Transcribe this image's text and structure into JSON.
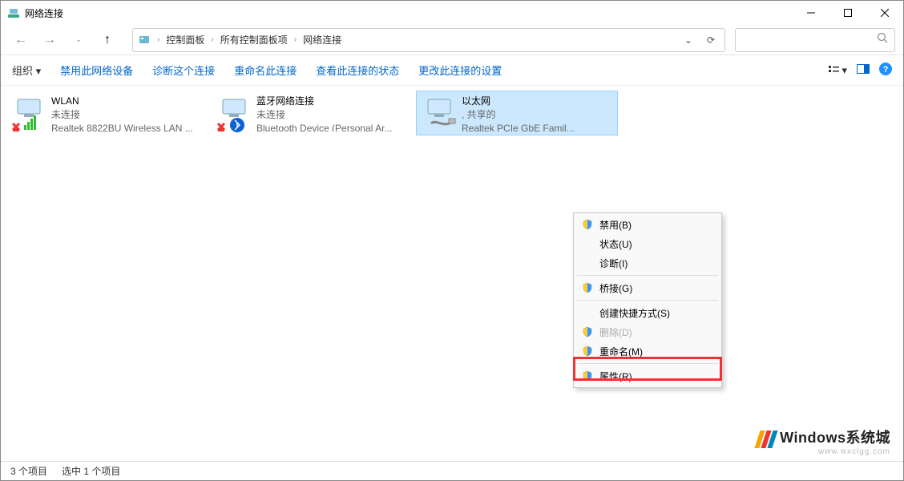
{
  "window": {
    "title": "网络连接"
  },
  "breadcrumbs": [
    "控制面板",
    "所有控制面板项",
    "网络连接"
  ],
  "toolbar": {
    "organize": "组织",
    "actions": [
      "禁用此网络设备",
      "诊断这个连接",
      "重命名此连接",
      "查看此连接的状态",
      "更改此连接的设置"
    ]
  },
  "adapters": [
    {
      "name": "WLAN",
      "status": "未连接",
      "device": "Realtek 8822BU Wireless LAN ..."
    },
    {
      "name": "蓝牙网络连接",
      "status": "未连接",
      "device": "Bluetooth Device (Personal Ar..."
    },
    {
      "name": "以太网",
      "status": ", 共享的",
      "device": "Realtek PCIe GbE Famil..."
    }
  ],
  "context_menu": [
    {
      "label": "禁用(B)",
      "shield": true
    },
    {
      "label": "状态(U)",
      "shield": false
    },
    {
      "label": "诊断(I)",
      "shield": false
    },
    {
      "sep": true
    },
    {
      "label": "桥接(G)",
      "shield": true
    },
    {
      "sep": true
    },
    {
      "label": "创建快捷方式(S)",
      "shield": false
    },
    {
      "label": "删除(D)",
      "shield": true,
      "disabled": true
    },
    {
      "label": "重命名(M)",
      "shield": true
    },
    {
      "sep": true
    },
    {
      "label": "属性(R)",
      "shield": true
    }
  ],
  "status_bar": {
    "count": "3 个项目",
    "selected": "选中 1 个项目"
  },
  "watermark": {
    "title": "Windows系统城",
    "sub": "www.wxclgg.com"
  }
}
